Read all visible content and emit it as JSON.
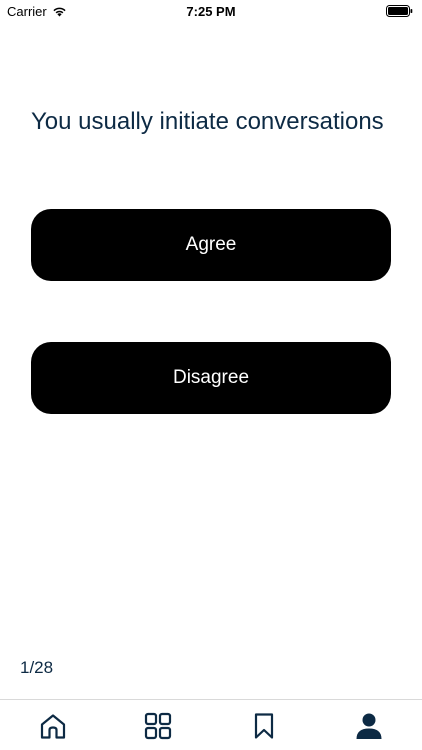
{
  "status_bar": {
    "carrier": "Carrier",
    "time": "7:25 PM",
    "icons": [
      "wifi-icon",
      "battery-icon"
    ]
  },
  "question": {
    "text": "You usually initiate conversations"
  },
  "answers": {
    "agree_label": "Agree",
    "disagree_label": "Disagree"
  },
  "progress": {
    "label": "1/28",
    "current": 1,
    "total": 28
  },
  "tab_bar": {
    "tabs": [
      {
        "icon": "home-icon",
        "selected": false
      },
      {
        "icon": "grid-icon",
        "selected": false
      },
      {
        "icon": "bookmark-icon",
        "selected": false
      },
      {
        "icon": "profile-icon",
        "selected": true
      }
    ]
  },
  "colors": {
    "text_primary": "#0d2a44",
    "button_bg": "#000000",
    "button_text": "#ffffff",
    "background": "#ffffff"
  }
}
